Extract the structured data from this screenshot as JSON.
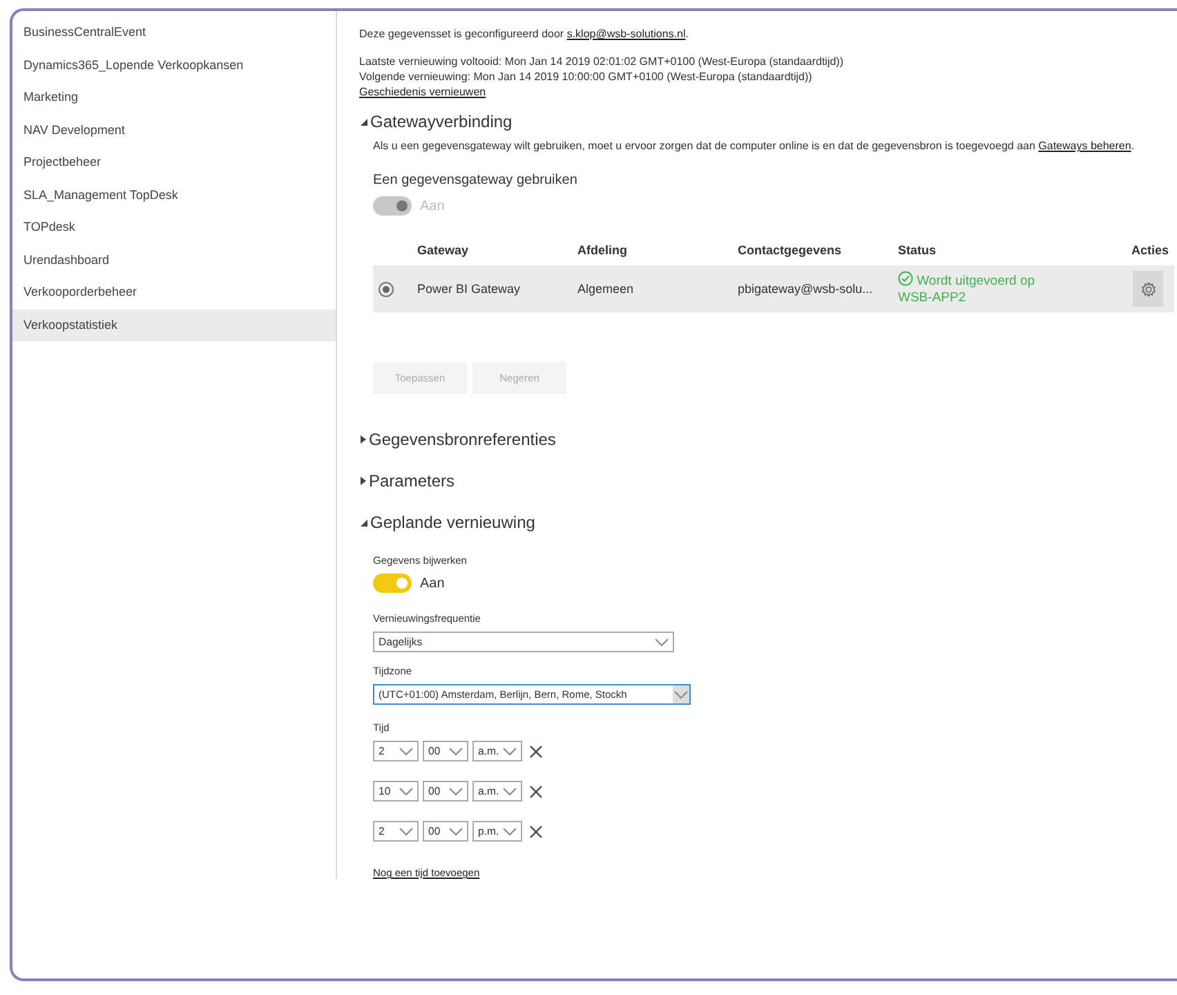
{
  "sidebar": {
    "items": [
      {
        "label": "BusinessCentralEvent",
        "selected": false
      },
      {
        "label": "Dynamics365_Lopende Verkoopkansen",
        "selected": false
      },
      {
        "label": "Marketing",
        "selected": false
      },
      {
        "label": "NAV Development",
        "selected": false
      },
      {
        "label": "Projectbeheer",
        "selected": false
      },
      {
        "label": "SLA_Management TopDesk",
        "selected": false
      },
      {
        "label": "TOPdesk",
        "selected": false
      },
      {
        "label": "Urendashboard",
        "selected": false
      },
      {
        "label": "Verkooporderbeheer",
        "selected": false
      },
      {
        "label": "Verkoopstatistiek",
        "selected": true
      }
    ]
  },
  "info": {
    "configured_prefix": "Deze gegevensset is geconfigureerd door ",
    "configured_link": "s.klop@wsb-solutions.nl",
    "configured_suffix": ".",
    "last_refresh": "Laatste vernieuwing voltooid: Mon Jan 14 2019 02:01:02 GMT+0100 (West-Europa (standaardtijd))",
    "next_refresh": "Volgende vernieuwing: Mon Jan 14 2019 10:00:00 GMT+0100 (West-Europa (standaardtijd))",
    "history_link": "Geschiedenis vernieuwen"
  },
  "gateway_section": {
    "title": "Gatewayverbinding",
    "expanded": true,
    "description": "Als u een gegevensgateway wilt gebruiken, moet u ervoor zorgen dat de computer online is en dat de gegevensbron is toegevoegd aan ",
    "description_link": "Gateways beheren",
    "description_suffix": ".",
    "toggle_label": "Een gegevensgateway gebruiken",
    "toggle": {
      "on": true,
      "disabled": true,
      "text": "Aan"
    },
    "table": {
      "columns": [
        "Gateway",
        "Afdeling",
        "Contactgegevens",
        "Status",
        "Acties"
      ],
      "rows": [
        {
          "selected": true,
          "gateway": "Power BI Gateway",
          "department": "Algemeen",
          "contact": "pbigateway@wsb-solu...",
          "status": "Wordt uitgevoerd op WSB-APP2"
        }
      ]
    },
    "buttons": [
      "Toepassen",
      "Negeren"
    ]
  },
  "collapsed_sections": [
    {
      "title": "Gegevensbronreferenties",
      "expanded": false
    },
    {
      "title": "Parameters",
      "expanded": false
    }
  ],
  "schedule_section": {
    "title": "Geplande vernieuwing",
    "expanded": true,
    "update_label": "Gegevens bijwerken",
    "toggle": {
      "on": true,
      "disabled": false,
      "text": "Aan"
    },
    "frequency_label": "Vernieuwingsfrequentie",
    "frequency_value": "Dagelijks",
    "timezone_label": "Tijdzone",
    "timezone_value": "(UTC+01:00) Amsterdam, Berlijn, Bern, Rome, Stockh",
    "time_label": "Tijd",
    "times": [
      {
        "hour": "2",
        "minute": "00",
        "period": "a.m."
      },
      {
        "hour": "10",
        "minute": "00",
        "period": "a.m."
      },
      {
        "hour": "2",
        "minute": "00",
        "period": "p.m."
      }
    ],
    "add_time_link": "Nog een tijd toevoegen"
  }
}
